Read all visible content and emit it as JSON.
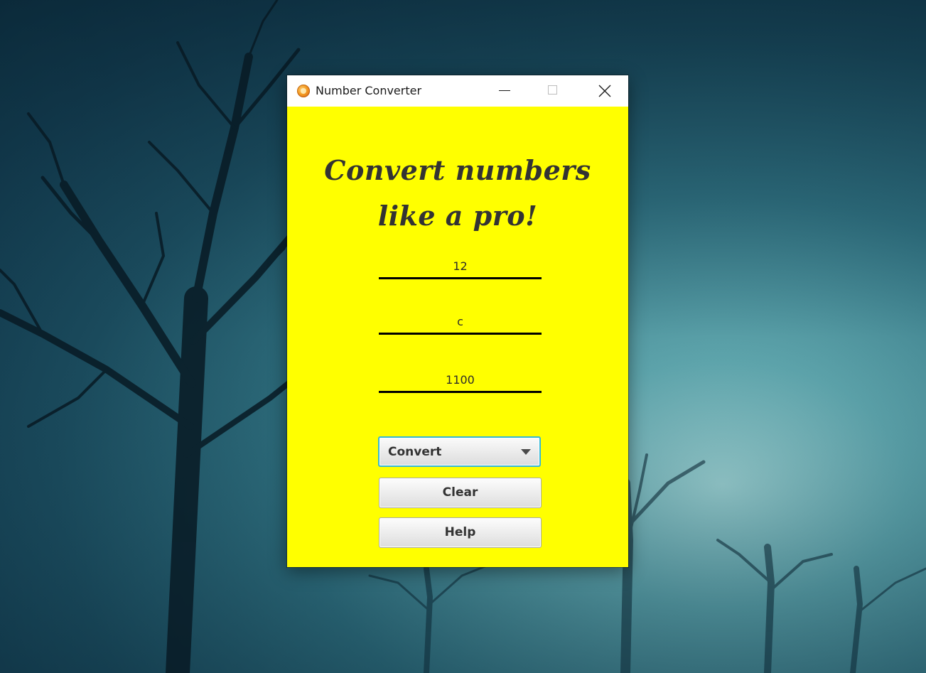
{
  "window": {
    "title": "Number Converter",
    "icon": "app-icon",
    "controls": [
      "minimize-icon",
      "maximize-icon",
      "close-icon"
    ]
  },
  "headline": {
    "line1": "Convert numbers",
    "line2": "like a pro!"
  },
  "fields": {
    "decimal_value": "12",
    "hex_value": "c",
    "binary_value": "1100"
  },
  "combo": {
    "selected": "Convert"
  },
  "buttons": {
    "clear": "Clear",
    "help": "Help"
  },
  "colors": {
    "background": "#ffff00",
    "headline": "#333333",
    "focus_ring": "#35b7d6"
  }
}
